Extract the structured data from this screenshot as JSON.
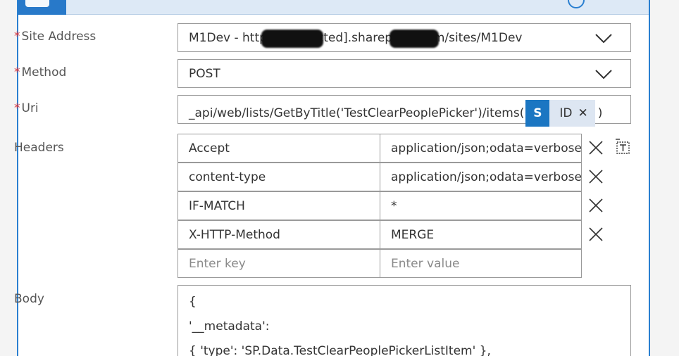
{
  "form": {
    "site_address": {
      "label": "Site Address",
      "required_mark": "*",
      "value": "M1Dev - https://[redacted].sharepoint.com/sites/M1Dev"
    },
    "method": {
      "label": "Method",
      "required_mark": "*",
      "value": "POST"
    },
    "uri": {
      "label": "Uri",
      "required_mark": "*",
      "prefix": "_api/web/lists/GetByTitle('TestClearPeoplePicker')/items(",
      "token_label": "ID",
      "token_icon_letter": "S",
      "suffix": ")"
    },
    "headers": {
      "label": "Headers",
      "rows": [
        {
          "key": "Accept",
          "value": "application/json;odata=verbose"
        },
        {
          "key": "content-type",
          "value": "application/json;odata=verbose"
        },
        {
          "key": "IF-MATCH",
          "value": "*"
        },
        {
          "key": "X-HTTP-Method",
          "value": "MERGE"
        }
      ],
      "key_placeholder": "Enter key",
      "value_placeholder": "Enter value"
    },
    "body": {
      "label": "Body",
      "lines": [
        "{",
        "'__metadata':",
        "{ 'type': 'SP.Data.TestClearPeoplePickerListItem' },"
      ]
    }
  },
  "colors": {
    "accent": "#2a7fd0",
    "required": "#d9363e",
    "token_bg": "#dde6f2",
    "token_icon": "#1b76c2"
  },
  "icons": [
    "chevron-down-icon",
    "close-icon",
    "switch-to-text-mode-icon",
    "sharepoint-icon",
    "info-icon"
  ]
}
